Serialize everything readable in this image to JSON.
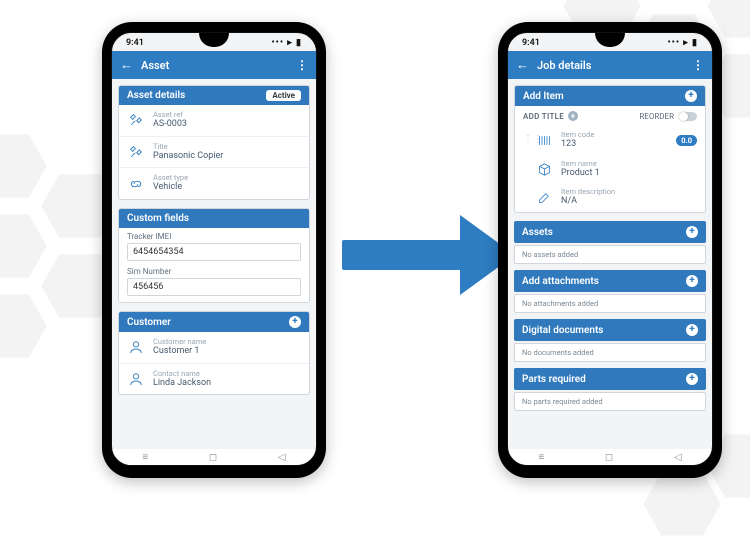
{
  "status": {
    "time": "9:41",
    "icons": "••• ▸ ▮"
  },
  "arrow_color": "#2e7cc1",
  "left": {
    "header_title": "Asset",
    "panels": {
      "asset_details": {
        "title": "Asset details",
        "badge": "Active",
        "rows": [
          {
            "label": "Asset ref",
            "value": "AS-0003"
          },
          {
            "label": "Title",
            "value": "Panasonic Copier"
          },
          {
            "label": "Asset type",
            "value": "Vehicle"
          }
        ]
      },
      "custom_fields": {
        "title": "Custom fields",
        "fields": [
          {
            "label": "Tracker IMEI",
            "value": "6454654354"
          },
          {
            "label": "Sim Number",
            "value": "456456"
          }
        ]
      },
      "customer": {
        "title": "Customer",
        "rows": [
          {
            "label": "Customer name",
            "value": "Customer 1"
          },
          {
            "label": "Contact name",
            "value": "Linda Jackson"
          }
        ]
      }
    }
  },
  "right": {
    "header_title": "Job details",
    "add_item": {
      "title": "Add Item",
      "add_title_label": "ADD TITLE",
      "reorder_label": "REORDER",
      "items": [
        {
          "label": "Item code",
          "value": "123",
          "pill": "0.0"
        },
        {
          "label": "Item name",
          "value": "Product 1"
        },
        {
          "label": "Item description",
          "value": "N/A"
        }
      ]
    },
    "sections": [
      {
        "title": "Assets",
        "empty": "No assets added"
      },
      {
        "title": "Add attachments",
        "empty": "No attachments added"
      },
      {
        "title": "Digital documents",
        "empty": "No documents added"
      },
      {
        "title": "Parts required",
        "empty": "No parts required added"
      }
    ]
  }
}
